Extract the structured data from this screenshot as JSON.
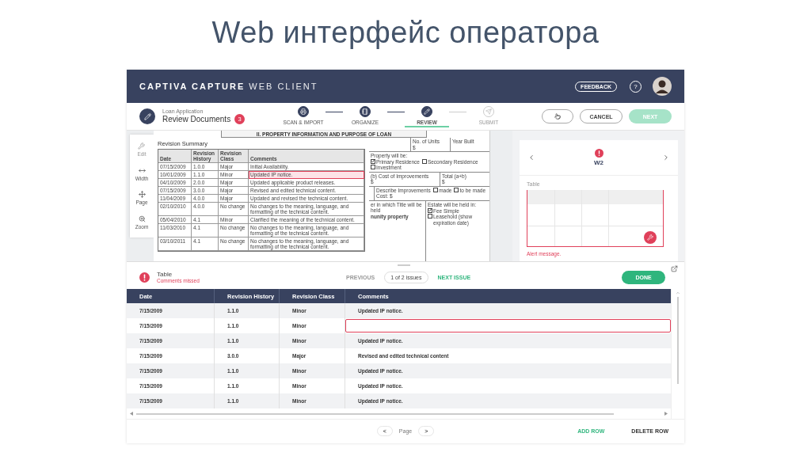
{
  "slide_title": "Web интерфейс оператора",
  "header": {
    "brand_bold": "CAPTIVA CAPTURE",
    "brand_light": "WEB CLIENT",
    "feedback": "FEEDBACK",
    "help": "?"
  },
  "task": {
    "subtitle": "Loan Application",
    "title": "Review Documents",
    "badge": "3"
  },
  "steps": [
    {
      "label": "SCAN & IMPORT",
      "kind": "scan",
      "completed": true,
      "selected": false
    },
    {
      "label": "ORGANIZE",
      "kind": "organize",
      "completed": true,
      "selected": false
    },
    {
      "label": "REVIEW",
      "kind": "review",
      "completed": false,
      "selected": true
    },
    {
      "label": "SUBMIT",
      "kind": "submit",
      "completed": false,
      "selected": false
    }
  ],
  "actions": {
    "cancel": "CANCEL",
    "next": "NEXT",
    "next_disabled": true
  },
  "tools": [
    {
      "label": "Edit",
      "kind": "edit",
      "disabled": true
    },
    {
      "label": "Width",
      "kind": "width",
      "disabled": false
    },
    {
      "label": "Page",
      "kind": "page",
      "disabled": false
    },
    {
      "label": "Zoom",
      "kind": "zoom",
      "disabled": false
    }
  ],
  "document": {
    "heading": "II. PROPERTY INFORMATION AND PURPOSE OF LOAN",
    "summary_title": "Revision Summary",
    "columns": [
      "Date",
      "Revision History",
      "Revision Class",
      "Comments"
    ],
    "rows": [
      {
        "cells": [
          "07/15/2009",
          "1.0.0",
          "Major",
          "Initial Availability."
        ],
        "highlighted": false
      },
      {
        "cells": [
          "10/01/2009",
          "1.1.0",
          "Minor",
          "Updated IP notice."
        ],
        "highlighted": true
      },
      {
        "cells": [
          "04/10/2009",
          "2.0.0",
          "Major",
          "Updated applicable product releases."
        ],
        "highlighted": false
      },
      {
        "cells": [
          "07/15/2009",
          "3.0.0",
          "Major",
          "Revised and edited technical content."
        ],
        "highlighted": false
      },
      {
        "cells": [
          "11/04/2009",
          "4.0.0",
          "Major",
          "Updated and revised the technical content."
        ],
        "highlighted": false
      },
      {
        "cells": [
          "02/10/2010",
          "4.0.0",
          "No change",
          "No changes to the meaning, language, and formatting of the technical content."
        ],
        "highlighted": false
      },
      {
        "cells": [
          "05/04/2010",
          "4.1",
          "Minor",
          "Clarified the meaning of the technical content."
        ],
        "highlighted": false
      },
      {
        "cells": [
          "11/03/2010",
          "4.1",
          "No change",
          "No changes to the meaning, language, and formatting of the technical content."
        ],
        "highlighted": false
      },
      {
        "cells": [
          "03/10/2011",
          "4.1",
          "No change",
          "No changes to the meaning, language, and formatting of the technical content."
        ],
        "highlighted": false
      }
    ],
    "form": {
      "units_label": "No. of Units",
      "units_value": "$",
      "year_label": "Year Built",
      "property_label": "Property will be:",
      "property_options": [
        {
          "label": "Primary Residence",
          "checked": true
        },
        {
          "label": "Secondary Residence",
          "checked": false
        },
        {
          "label": "Investment",
          "checked": false
        }
      ],
      "cost_label": "(b) Cost of Improvements",
      "total_label": "Total (a+b)",
      "cost_value": "$",
      "total_value": "$",
      "describe_label": "Describe Improvements",
      "improvement_options": [
        {
          "label": "made",
          "checked": false
        },
        {
          "label": "to be made",
          "checked": false
        }
      ],
      "cost2_label": "Cost: $",
      "title_label": "er in which Title will be held",
      "title_value": "nunity property",
      "estate_label": "Estate will be held in:",
      "estate_options": [
        {
          "label": "Fee Simple",
          "checked": true
        },
        {
          "label": "Leasehold (show expiration date)",
          "checked": false
        }
      ]
    }
  },
  "side_panel": {
    "document": "W2",
    "error": true,
    "field_label": "Table",
    "alert": "Alert message."
  },
  "issue": {
    "title": "Table",
    "message": "Comments missed",
    "previous": "PREVIOUS",
    "counter": "1 of 2 issues",
    "next": "NEXT ISSUE",
    "done": "DONE"
  },
  "table": {
    "columns": [
      "Date",
      "Revision History",
      "Revision Class",
      "Comments"
    ],
    "rows": [
      {
        "cells": [
          "7/15/2009",
          "1.1.0",
          "Minor",
          "Updated IP notice."
        ],
        "error": false
      },
      {
        "cells": [
          "7/15/2009",
          "1.1.0",
          "Minor",
          ""
        ],
        "error": true
      },
      {
        "cells": [
          "7/15/2009",
          "1.1.0",
          "Minor",
          "Updated IP notice."
        ],
        "error": false
      },
      {
        "cells": [
          "7/15/2009",
          "3.0.0",
          "Major",
          "Revised and edited technical content"
        ],
        "error": false
      },
      {
        "cells": [
          "7/15/2009",
          "1.1.0",
          "Minor",
          "Updated IP notice."
        ],
        "error": false
      },
      {
        "cells": [
          "7/15/2009",
          "1.1.0",
          "Minor",
          "Updated IP notice."
        ],
        "error": false
      },
      {
        "cells": [
          "7/15/2009",
          "1.1.0",
          "Minor",
          "Updated IP notice."
        ],
        "error": false
      }
    ]
  },
  "footer": {
    "prev": "<",
    "page": "Page",
    "next": ">",
    "add_row": "ADD ROW",
    "delete_row": "DELETE ROW"
  }
}
